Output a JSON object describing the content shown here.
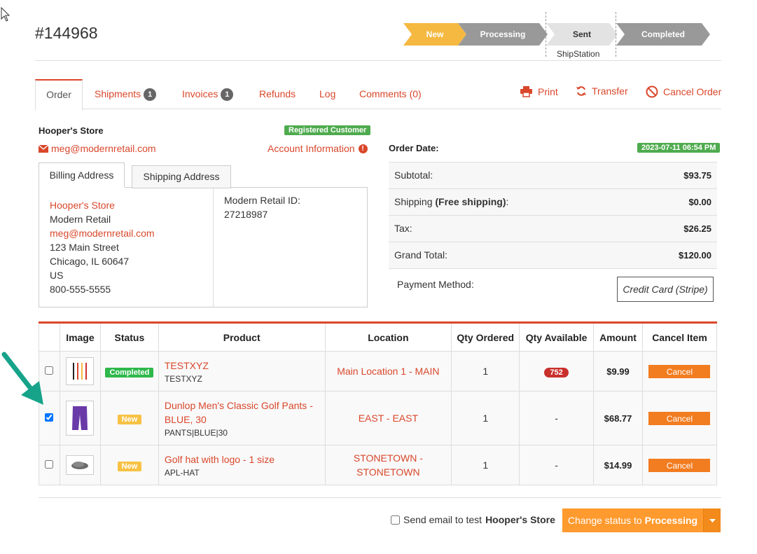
{
  "order": {
    "id": "#144968"
  },
  "workflow": {
    "steps": [
      "New",
      "Processing",
      "Sent",
      "Completed"
    ],
    "sub_label": "ShipStation"
  },
  "tabs": {
    "order": "Order",
    "shipments": "Shipments",
    "shipments_count": "1",
    "invoices": "Invoices",
    "invoices_count": "1",
    "refunds": "Refunds",
    "log": "Log",
    "comments": "Comments (0)"
  },
  "actions": {
    "print": "Print",
    "transfer": "Transfer",
    "cancel_order": "Cancel Order"
  },
  "customer": {
    "store": "Hooper's Store",
    "badge": "Registered Customer",
    "email": "meg@modernretail.com",
    "account_info": "Account Information",
    "info_glyph": "!"
  },
  "address_tabs": {
    "billing": "Billing Address",
    "shipping": "Shipping Address"
  },
  "billing": {
    "name": "Hooper's Store",
    "company": "Modern Retail",
    "email": "meg@modernretail.com",
    "street": "123 Main Street",
    "city": "Chicago, IL 60647",
    "country": "US",
    "phone": "800-555-5555",
    "mr_id_label": "Modern Retail ID:",
    "mr_id": "27218987"
  },
  "summary": {
    "order_date_label": "Order Date:",
    "order_date": "2023-07-11 06:54 PM",
    "subtotal_label": "Subtotal:",
    "subtotal": "$93.75",
    "shipping_label": "Shipping",
    "shipping_note": "(Free shipping)",
    "shipping_colon": ":",
    "shipping": "$0.00",
    "tax_label": "Tax:",
    "tax": "$26.25",
    "grand_total_label": "Grand Total:",
    "grand_total": "$120.00",
    "payment_method_label": "Payment Method:",
    "payment_method": "Credit Card (Stripe)"
  },
  "table": {
    "headers": [
      "Image",
      "Status",
      "Product",
      "Location",
      "Qty Ordered",
      "Qty Available",
      "Amount",
      "Cancel Item"
    ],
    "rows": [
      {
        "checked": false,
        "status": "Completed",
        "product": "TESTXYZ",
        "sku": "TESTXYZ",
        "location": "Main Location 1 - MAIN",
        "qty_ordered": "1",
        "qty_available": "752",
        "amount": "$9.99",
        "cancel": "Cancel"
      },
      {
        "checked": true,
        "status": "New",
        "product": "Dunlop Men's Classic Golf Pants - BLUE, 30",
        "sku": "PANTS|BLUE|30",
        "location": "EAST - EAST",
        "qty_ordered": "1",
        "qty_available": "-",
        "amount": "$68.77",
        "cancel": "Cancel"
      },
      {
        "checked": false,
        "status": "New",
        "product": "Golf hat with logo - 1 size",
        "sku": "APL-HAT",
        "location": "STONETOWN - STONETOWN",
        "qty_ordered": "1",
        "qty_available": "-",
        "amount": "$14.99",
        "cancel": "Cancel"
      }
    ]
  },
  "footer": {
    "send_email_prefix": "Send email to test",
    "send_email_store": "Hooper's Store",
    "change_status_prefix": "Change status to",
    "change_status_target": "Processing"
  },
  "colors": {
    "accent": "#d9472b",
    "orange": "#f27c20",
    "green": "#4fab4f",
    "new_yellow": "#f5b942",
    "annotation_arrow": "#17a389"
  }
}
